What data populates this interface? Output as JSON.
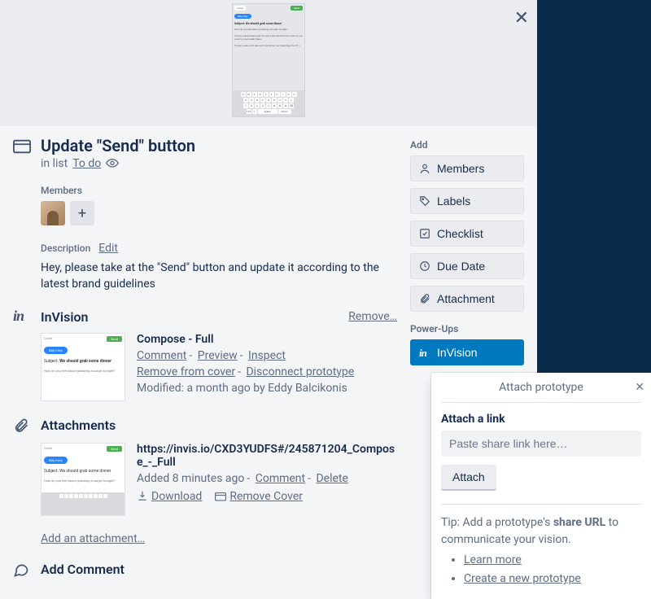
{
  "cover": {
    "close_label": "Close",
    "send_label": "Send",
    "pill": "Billy Kiely",
    "subject": "Subject: We should grab some dinner",
    "body1": "How do you feel about grabbing a burger tonight?",
    "body2": "I know a great place and it's only a few blocks from work so we could (or just walk) there.",
    "body3": "I have to stay a bit late, but how about we meet there for 8? :)"
  },
  "card": {
    "title": "Update \"Send\" button",
    "in_list_prefix": "in list ",
    "list_name": "To do"
  },
  "members": {
    "label": "Members"
  },
  "description": {
    "label": "Description",
    "edit": "Edit",
    "text": "Hey, please take at the \"Send\" button and update it according to the latest brand guidelines"
  },
  "invision": {
    "title": "InVision",
    "remove": "Remove…",
    "att_title": "Compose - Full",
    "comment": "Comment",
    "preview": "Preview",
    "inspect": "Inspect",
    "remove_cover": "Remove from cover",
    "disconnect": "Disconnect prototype",
    "modified": "Modified: a month ago by Eddy Balcikonis"
  },
  "attachments": {
    "title": "Attachments",
    "item_title": "https://invis.io/CXD3YUDFS#/245871204_Compose_-_Full",
    "added": "Added 8 minutes ago",
    "comment": "Comment",
    "delete": "Delete",
    "download": "Download",
    "remove_cover": "Remove Cover",
    "add_link": "Add an attachment…"
  },
  "comment": {
    "title": "Add Comment"
  },
  "sidebar": {
    "add_header": "Add",
    "members": "Members",
    "labels": "Labels",
    "checklist": "Checklist",
    "due_date": "Due Date",
    "attachment": "Attachment",
    "powerups_header": "Power-Ups",
    "invision": "InVision"
  },
  "popover": {
    "title": "Attach prototype",
    "link_label": "Attach a link",
    "placeholder": "Paste share link here…",
    "attach_btn": "Attach",
    "tip_prefix": "Tip: Add a prototype's ",
    "tip_bold": "share URL",
    "tip_suffix": " to communicate your vision.",
    "learn_more": "Learn more",
    "create_new": "Create a new prototype"
  }
}
